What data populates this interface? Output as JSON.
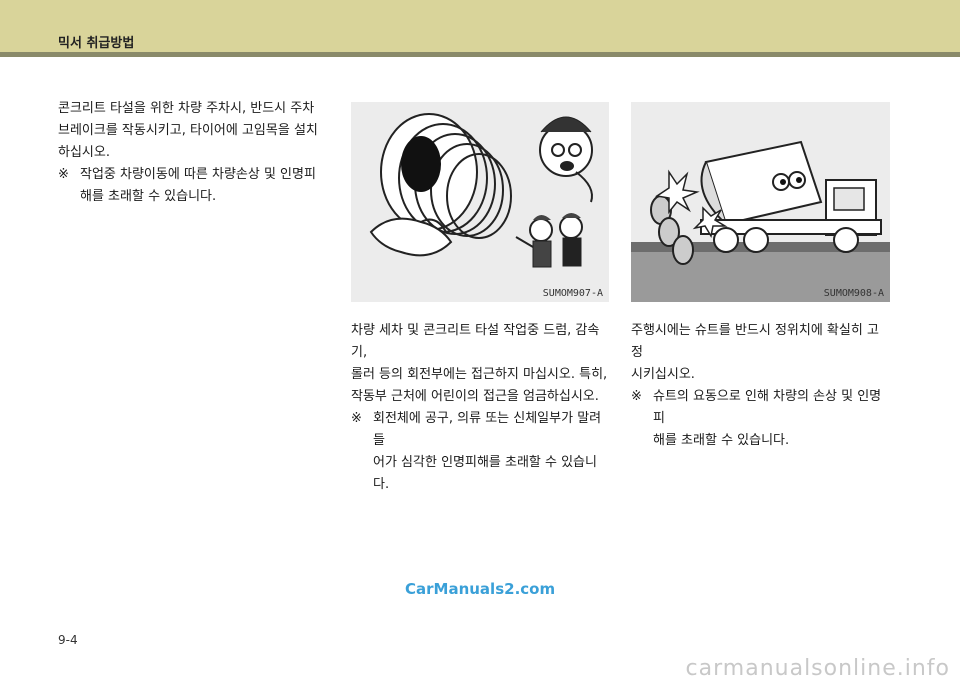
{
  "header": {
    "title": "믹서 취급방법"
  },
  "left_column": {
    "para_lines": [
      "콘크리트 타설을 위한 차량 주차시, 반드시 주차",
      "브레이크를 작동시키고, 타이어에 고임목을 설치",
      "하십시오."
    ],
    "note_mark": "※",
    "note_lines": [
      "작업중 차량이동에 따른 차량손상 및 인명피",
      "해를 초래할 수 있습니다."
    ]
  },
  "middle_column": {
    "figure_code": "SUMOM907-A",
    "para_lines": [
      "차량 세차 및 콘크리트 타설 작업중 드럼, 감속기,",
      "롤러 등의 회전부에는 접근하지 마십시오. 특히,",
      "작동부 근처에 어린이의 접근을 엄금하십시오."
    ],
    "note_mark": "※",
    "note_lines": [
      "회전체에 공구, 의류 또는 신체일부가 말려들",
      "어가 심각한 인명피해를 초래할 수 있습니다."
    ]
  },
  "right_column": {
    "figure_code": "SUMOM908-A",
    "para_lines": [
      "주행시에는 슈트를 반드시 정위치에 확실히 고정",
      "시키십시오."
    ],
    "note_mark": "※",
    "note_lines": [
      "슈트의 요동으로 인해 차량의 손상 및 인명피",
      "해를 초래할 수 있습니다."
    ]
  },
  "watermark_mid": "CarManuals2.com",
  "watermark_bottom": "carmanualsonline.info",
  "page_number": "9-4"
}
